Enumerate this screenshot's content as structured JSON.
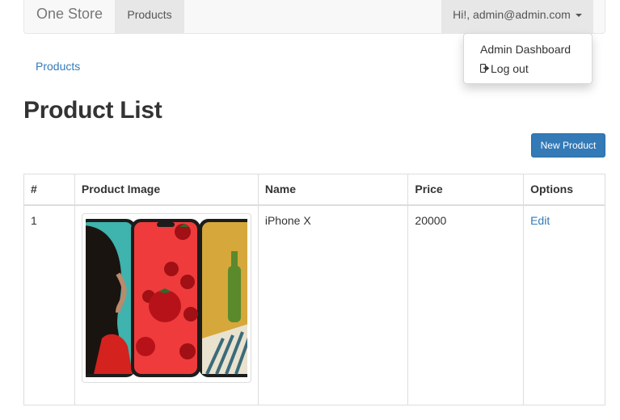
{
  "navbar": {
    "brand": "One Store",
    "active_item": "Products",
    "user_menu": "Hi!, admin@admin.com"
  },
  "dropdown": {
    "items": [
      "Admin Dashboard",
      "Log out"
    ],
    "logout_icon": "logout-icon"
  },
  "breadcrumb": "Products",
  "page_title": "Product List",
  "new_product_button": "New Product",
  "table": {
    "headers": [
      "#",
      "Product Image",
      "Name",
      "Price",
      "Options"
    ],
    "rows": [
      {
        "num": "1",
        "name": "iPhone X",
        "price": "20000",
        "option": "Edit"
      }
    ]
  },
  "colors": {
    "link": "#337ab7",
    "primary_button": "#337ab7",
    "navbar_bg": "#f8f8f8",
    "nav_active_bg": "#e7e7e7"
  }
}
